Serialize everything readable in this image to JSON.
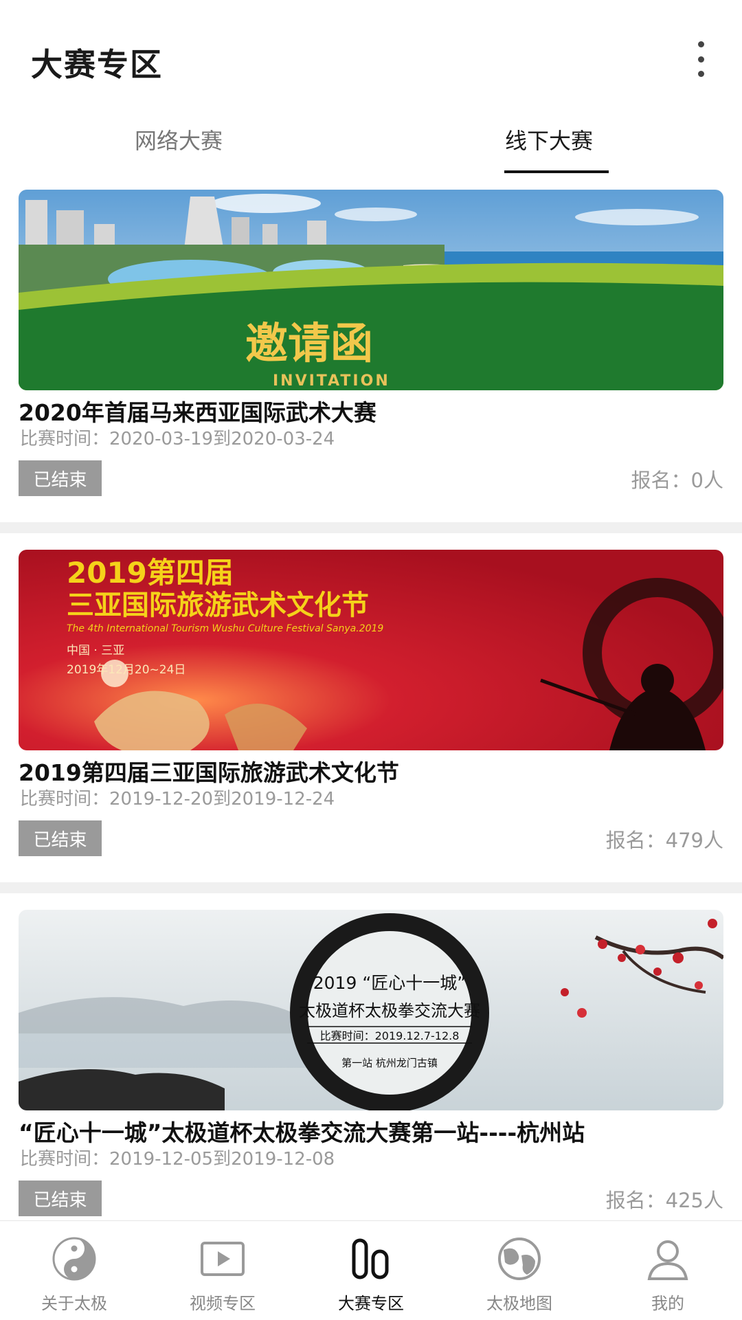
{
  "app_bar": {
    "title": "大赛专区",
    "menu_icon": "more-vert-icon"
  },
  "tabs": [
    {
      "label": "网络大赛",
      "selected": false
    },
    {
      "label": "线下大赛",
      "selected": true
    }
  ],
  "events": [
    {
      "banner": {
        "heading": "邀请函",
        "subheading": "INVITATION"
      },
      "title": "2020年首届马来西亚国际武术大赛",
      "time": "比赛时间：2020-03-19到2020-03-24",
      "status": "已结束",
      "signup": "报名：0人"
    },
    {
      "banner": {
        "line1": "2019第四届",
        "line2": "三亚国际旅游武术文化节",
        "line3": "The 4th International Tourism Wushu Culture Festival  Sanya.2019",
        "line4": "中国 · 三亚",
        "line5": "2019年12月20~24日"
      },
      "title": "2019第四届三亚国际旅游武术文化节",
      "time": "比赛时间：2019-12-20到2019-12-24",
      "status": "已结束",
      "signup": "报名：479人"
    },
    {
      "banner": {
        "line1": "2019 “匠心十一城”",
        "line2": "太极道杯太极拳交流大赛",
        "line3": "比赛时间：2019.12.7-12.8",
        "line4": "第一站 杭州龙门古镇"
      },
      "title": "“匠心十一城”太极道杯太极拳交流大赛第一站----杭州站",
      "time": "比赛时间：2019-12-05到2019-12-08",
      "status": "已结束",
      "signup": "报名：425人"
    }
  ],
  "bottom_nav": [
    {
      "label": "关于太极",
      "icon": "yin-yang-icon",
      "active": false
    },
    {
      "label": "视频专区",
      "icon": "video-play-icon",
      "active": false
    },
    {
      "label": "大赛专区",
      "icon": "competition-icon",
      "active": true
    },
    {
      "label": "太极地图",
      "icon": "taiji-map-icon",
      "active": false
    },
    {
      "label": "我的",
      "icon": "user-profile-icon",
      "active": false
    }
  ],
  "colors": {
    "status_badge": "#9a9a9a",
    "secondary_text": "#9a9a9a",
    "invitation_green": "#1f7a2e",
    "festival_red": "#c8142a",
    "festival_yellow": "#f5d21a"
  }
}
